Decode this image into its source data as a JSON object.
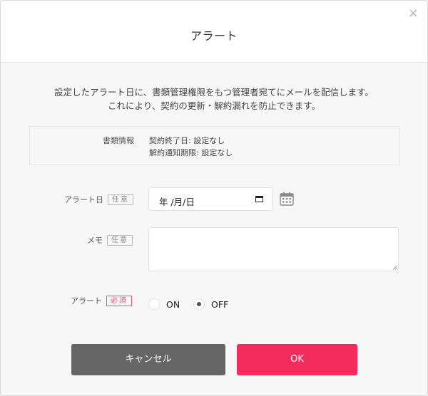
{
  "dialog": {
    "title": "アラート",
    "close_glyph": "×"
  },
  "description": {
    "line1": "設定したアラート日に、書類管理権限をもつ管理者宛てにメールを配信します。",
    "line2": "これにより、契約の更新・解約漏れを防止できます。"
  },
  "document_info": {
    "label": "書類情報",
    "contract_end": "契約終了日: 設定なし",
    "cancel_notice": "解約通知期限: 設定なし"
  },
  "alert_date": {
    "label": "アラート日",
    "badge": "任意",
    "value": "年 /月/日",
    "icon": "calendar-icon"
  },
  "memo": {
    "label": "メモ",
    "badge": "任意",
    "value": ""
  },
  "alert_toggle": {
    "label": "アラート",
    "badge": "必須",
    "options": [
      "ON",
      "OFF"
    ],
    "selected": "OFF"
  },
  "buttons": {
    "cancel": "キャンセル",
    "ok": "OK"
  },
  "colors": {
    "accent": "#f42c5d",
    "cancel_button": "#666666",
    "required_badge": "#e8506f"
  }
}
